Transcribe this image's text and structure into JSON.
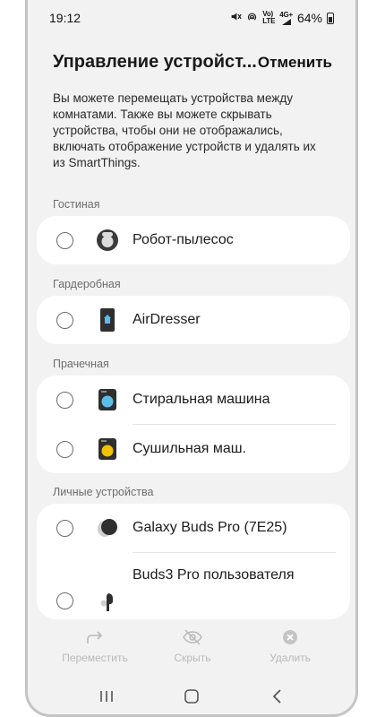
{
  "status_bar": {
    "time": "19:12",
    "network_top": "Vo)",
    "network_bottom": "LTE",
    "network_gen": "4G+",
    "battery": "64%"
  },
  "header": {
    "title": "Управление устройст...",
    "cancel_label": "Отменить"
  },
  "description": "Вы можете перемещать устройства между комнатами. Также вы можете скрывать устройства, чтобы они не отображались, включать отображение устройств и удалять их из SmartThings.",
  "sections": [
    {
      "label": "Гостиная",
      "devices": [
        {
          "label": "Робот-пылесос",
          "icon": "robot-vacuum-icon"
        }
      ]
    },
    {
      "label": "Гардеробная",
      "devices": [
        {
          "label": "AirDresser",
          "icon": "airdresser-icon"
        }
      ]
    },
    {
      "label": "Прачечная",
      "devices": [
        {
          "label": "Стиральная машина",
          "icon": "washer-icon"
        },
        {
          "label": "Сушильная маш.",
          "icon": "dryer-icon"
        }
      ]
    },
    {
      "label": "Личные устройства",
      "devices": [
        {
          "label": "Galaxy Buds Pro (7E25)",
          "icon": "buds-case-icon"
        },
        {
          "label": "Buds3 Pro пользователя",
          "icon": "earbud-icon"
        }
      ]
    }
  ],
  "actions": [
    {
      "label": "Переместить",
      "icon": "move-icon"
    },
    {
      "label": "Скрыть",
      "icon": "hide-icon"
    },
    {
      "label": "Удалить",
      "icon": "remove-icon"
    }
  ],
  "colors": {
    "background": "#f2f2f2",
    "card": "#ffffff",
    "disabled": "#b9b9b9",
    "washer_accent": "#5bbde8",
    "dryer_accent": "#f2c200"
  }
}
